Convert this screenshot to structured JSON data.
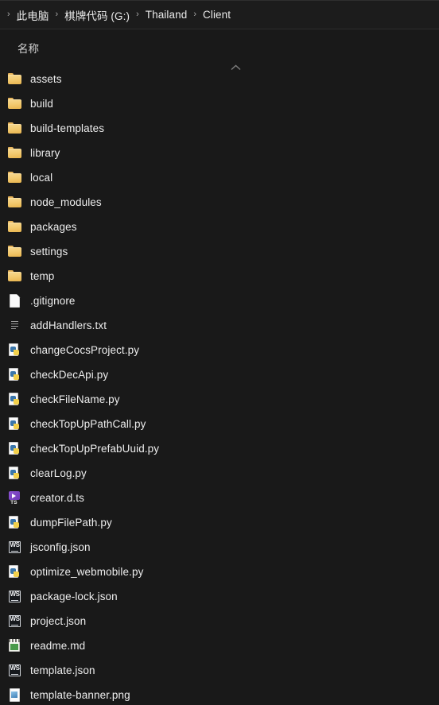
{
  "window": {
    "theme": "dark",
    "background_color": "#191919",
    "addressbar_color": "#1c1c1c",
    "text_color": "#ededed",
    "folder_icon_color": "#f3cb72"
  },
  "addressbar": {
    "leading_separator": "›",
    "separator": "›",
    "crumbs": [
      {
        "label": "此电脑"
      },
      {
        "label": "棋牌代码 (G:)"
      },
      {
        "label": "Thailand"
      },
      {
        "label": "Client"
      }
    ]
  },
  "column_header": {
    "name_label": "名称",
    "sort_indicator": "chevron-up-icon",
    "sort_direction": "ascending"
  },
  "file_list": {
    "items": [
      {
        "name": "assets",
        "type": "folder",
        "icon": "folder-icon"
      },
      {
        "name": "build",
        "type": "folder",
        "icon": "folder-icon"
      },
      {
        "name": "build-templates",
        "type": "folder",
        "icon": "folder-icon"
      },
      {
        "name": "library",
        "type": "folder",
        "icon": "folder-icon"
      },
      {
        "name": "local",
        "type": "folder",
        "icon": "folder-icon"
      },
      {
        "name": "node_modules",
        "type": "folder",
        "icon": "folder-icon"
      },
      {
        "name": "packages",
        "type": "folder",
        "icon": "folder-icon"
      },
      {
        "name": "settings",
        "type": "folder",
        "icon": "folder-icon"
      },
      {
        "name": "temp",
        "type": "folder",
        "icon": "folder-icon"
      },
      {
        "name": ".gitignore",
        "type": "file",
        "icon": "page-icon"
      },
      {
        "name": "addHandlers.txt",
        "type": "file",
        "icon": "text-file-icon"
      },
      {
        "name": "changeCocsProject.py",
        "type": "file",
        "icon": "python-file-icon"
      },
      {
        "name": "checkDecApi.py",
        "type": "file",
        "icon": "python-file-icon"
      },
      {
        "name": "checkFileName.py",
        "type": "file",
        "icon": "python-file-icon"
      },
      {
        "name": "checkTopUpPathCall.py",
        "type": "file",
        "icon": "python-file-icon"
      },
      {
        "name": "checkTopUpPrefabUuid.py",
        "type": "file",
        "icon": "python-file-icon"
      },
      {
        "name": "clearLog.py",
        "type": "file",
        "icon": "python-file-icon"
      },
      {
        "name": "creator.d.ts",
        "type": "file",
        "icon": "typescript-file-icon"
      },
      {
        "name": "dumpFilePath.py",
        "type": "file",
        "icon": "python-file-icon"
      },
      {
        "name": "jsconfig.json",
        "type": "file",
        "icon": "webstorm-file-icon"
      },
      {
        "name": "optimize_webmobile.py",
        "type": "file",
        "icon": "python-file-icon"
      },
      {
        "name": "package-lock.json",
        "type": "file",
        "icon": "webstorm-file-icon"
      },
      {
        "name": "project.json",
        "type": "file",
        "icon": "webstorm-file-icon"
      },
      {
        "name": "readme.md",
        "type": "file",
        "icon": "markdown-file-icon"
      },
      {
        "name": "template.json",
        "type": "file",
        "icon": "webstorm-file-icon"
      },
      {
        "name": "template-banner.png",
        "type": "file",
        "icon": "image-file-icon"
      }
    ]
  },
  "icon_labels": {
    "webstorm": "WS",
    "typescript": "TS"
  }
}
